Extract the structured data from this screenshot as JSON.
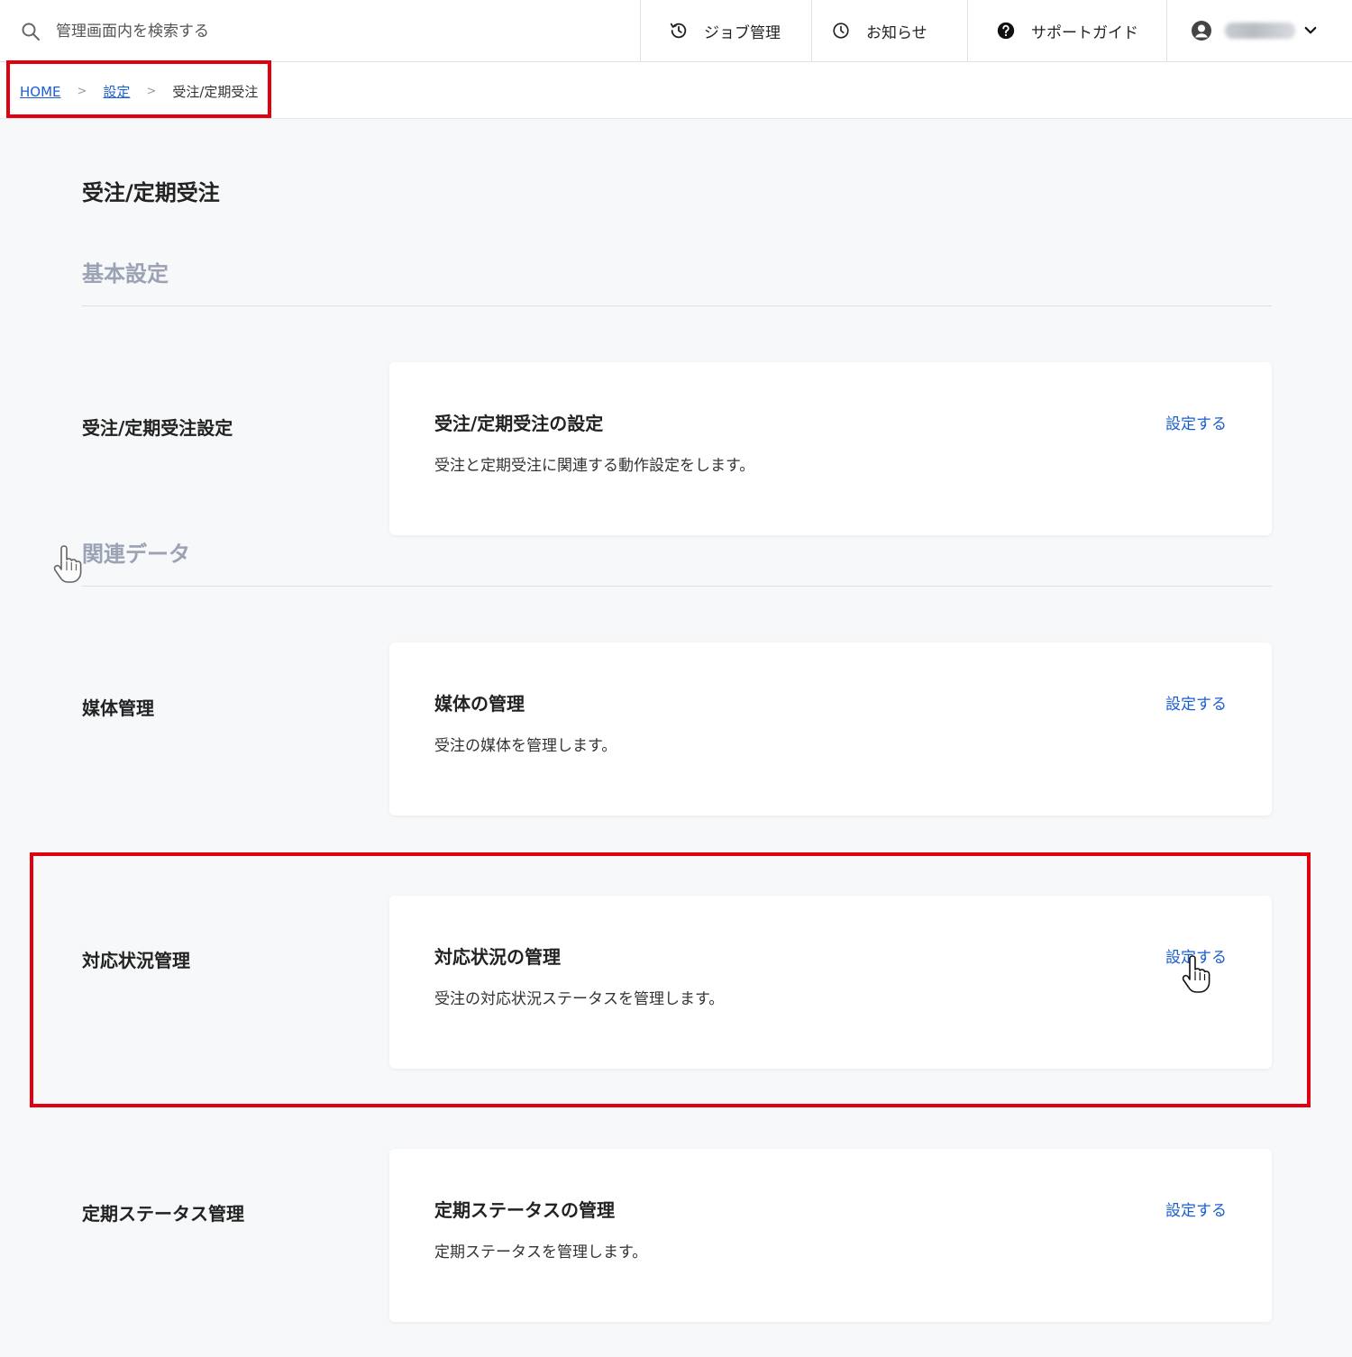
{
  "header": {
    "search_placeholder": "管理画面内を検索する",
    "nav": {
      "job": "ジョブ管理",
      "news": "お知らせ",
      "guide": "サポートガイド"
    }
  },
  "breadcrumb": {
    "home": "HOME",
    "settings": "設定",
    "separator": ">",
    "current": "受注/定期受注"
  },
  "page": {
    "title": "受注/定期受注"
  },
  "sections": {
    "basic": "基本設定",
    "related": "関連データ"
  },
  "rows": [
    {
      "label": "受注/定期受注設定",
      "card_title": "受注/定期受注の設定",
      "card_desc": "受注と定期受注に関連する動作設定をします。",
      "link": "設定する"
    },
    {
      "label": "媒体管理",
      "card_title": "媒体の管理",
      "card_desc": "受注の媒体を管理します。",
      "link": "設定する"
    },
    {
      "label": "対応状況管理",
      "card_title": "対応状況の管理",
      "card_desc": "受注の対応状況ステータスを管理します。",
      "link": "設定する"
    },
    {
      "label": "定期ステータス管理",
      "card_title": "定期ステータスの管理",
      "card_desc": "定期ステータスを管理します。",
      "link": "設定する"
    }
  ],
  "colors": {
    "link": "#1a5fd1",
    "highlight": "#e0000f",
    "section_heading": "#9aa2b3",
    "background": "#f7f8fa"
  },
  "icons": {
    "search": "search-icon",
    "history": "history-icon",
    "clock": "clock-icon",
    "help": "help-circle-icon",
    "user": "user-avatar-icon",
    "dropdown": "chevron-down-icon",
    "cursor": "hand-pointer-icon"
  }
}
